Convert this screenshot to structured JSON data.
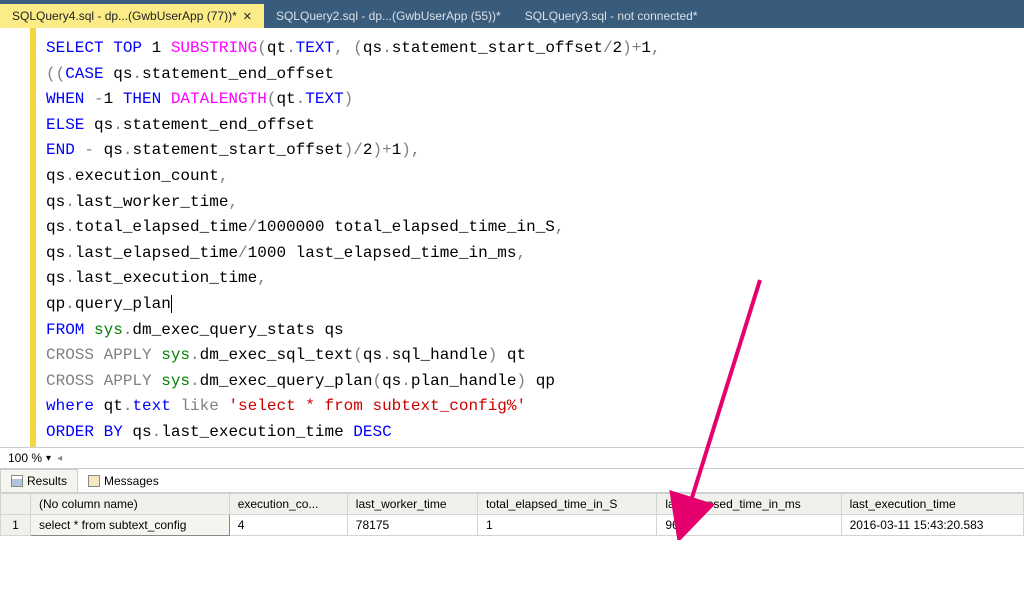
{
  "tabs": [
    {
      "label": "SQLQuery4.sql - dp...(GwbUserApp (77))*",
      "active": true
    },
    {
      "label": "SQLQuery2.sql - dp...(GwbUserApp (55))*",
      "active": false
    },
    {
      "label": "SQLQuery3.sql - not connected*",
      "active": false
    }
  ],
  "code": {
    "l1": {
      "p1": "SELECT",
      "p2": " TOP ",
      "p3": "1 ",
      "p4": "SUBSTRING",
      "p5": "(",
      "p6": "qt",
      "p7": ".",
      "p8": "TEXT",
      "p9": ", (",
      "p10": "qs",
      "p11": ".",
      "p12": "statement_start_offset",
      "p13": "/",
      "p14": "2",
      "p15": ")+",
      "p16": "1",
      "p17": ","
    },
    "l2": {
      "p1": "((",
      "p2": "CASE",
      "p3": " qs",
      "p4": ".",
      "p5": "statement_end_offset"
    },
    "l3": {
      "p1": "WHEN",
      "p2": " -",
      "p3": "1 ",
      "p4": "THEN",
      "p5": " DATALENGTH",
      "p6": "(",
      "p7": "qt",
      "p8": ".",
      "p9": "TEXT",
      "p10": ")"
    },
    "l4": {
      "p1": "ELSE",
      "p2": " qs",
      "p3": ".",
      "p4": "statement_end_offset"
    },
    "l5": {
      "p1": "END",
      "p2": " - ",
      "p3": "qs",
      "p4": ".",
      "p5": "statement_start_offset",
      "p6": ")/",
      "p7": "2",
      "p8": ")+",
      "p9": "1",
      "p10": "),"
    },
    "l6": {
      "p1": "qs",
      "p2": ".",
      "p3": "execution_count",
      "p4": ","
    },
    "l7": {
      "p1": "qs",
      "p2": ".",
      "p3": "last_worker_time",
      "p4": ","
    },
    "l8": {
      "p1": "qs",
      "p2": ".",
      "p3": "total_elapsed_time",
      "p4": "/",
      "p5": "1000000 ",
      "p6": "total_elapsed_time_in_S",
      "p7": ","
    },
    "l9": {
      "p1": "qs",
      "p2": ".",
      "p3": "last_elapsed_time",
      "p4": "/",
      "p5": "1000 ",
      "p6": "last_elapsed_time_in_ms",
      "p7": ","
    },
    "l10": {
      "p1": "qs",
      "p2": ".",
      "p3": "last_execution_time",
      "p4": ","
    },
    "l11": {
      "p1": "qp",
      "p2": ".",
      "p3": "query_plan"
    },
    "l12": {
      "p1": "FROM",
      "p2": " sys",
      "p3": ".",
      "p4": "dm_exec_query_stats ",
      "p5": "qs"
    },
    "l13": {
      "p1": "CROSS",
      "p2": " APPLY",
      "p3": " sys",
      "p4": ".",
      "p5": "dm_exec_sql_text",
      "p6": "(",
      "p7": "qs",
      "p8": ".",
      "p9": "sql_handle",
      "p10": ") ",
      "p11": "qt"
    },
    "l14": {
      "p1": "CROSS",
      "p2": " APPLY",
      "p3": " sys",
      "p4": ".",
      "p5": "dm_exec_query_plan",
      "p6": "(",
      "p7": "qs",
      "p8": ".",
      "p9": "plan_handle",
      "p10": ") ",
      "p11": "qp"
    },
    "l15": {
      "p1": "where",
      "p2": " qt",
      "p3": ".",
      "p4": "text",
      "p5": " like ",
      "p6": "'select * from subtext_config%'"
    },
    "l16": {
      "p1": "ORDER",
      "p2": " BY",
      "p3": " qs",
      "p4": ".",
      "p5": "last_execution_time ",
      "p6": "DESC"
    }
  },
  "zoom": "100 %",
  "result_tabs": {
    "results": "Results",
    "messages": "Messages"
  },
  "grid": {
    "headers": [
      "",
      "(No column name)",
      "execution_co...",
      "last_worker_time",
      "total_elapsed_time_in_S",
      "last_elapsed_time_in_ms",
      "last_execution_time"
    ],
    "rows": [
      {
        "num": "1",
        "cells": [
          "select * from subtext_config",
          "4",
          "78175",
          "1",
          "96",
          "2016-03-11 15:43:20.583"
        ]
      }
    ]
  }
}
